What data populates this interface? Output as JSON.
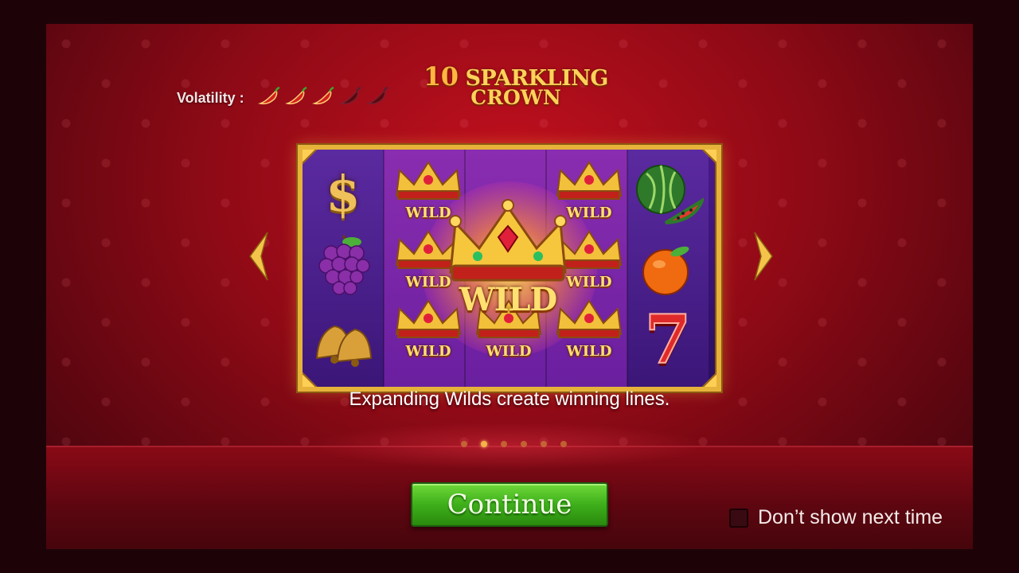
{
  "game": {
    "title_line1_number": "10",
    "title_line1_word": "SPARKLING",
    "title_line2": "CROWN"
  },
  "volatility": {
    "label": "Volatility :",
    "level": 3,
    "max": 5,
    "icon": "chili-pepper-icon"
  },
  "slide": {
    "caption": "Expanding Wilds create winning lines.",
    "wild_small_label": "WILD",
    "wild_big_label": "WILD",
    "symbols": {
      "dollar": "$",
      "seven": "7"
    }
  },
  "pagination": {
    "count": 6,
    "active_index": 1
  },
  "controls": {
    "continue_label": "Continue",
    "dont_show_label": "Don’t show next time",
    "dont_show_checked": false
  },
  "colors": {
    "background": "#8f0a16",
    "frame_gold": "#e6b23a",
    "button_green": "#3eaf1a",
    "chili_active": "#d42020",
    "chili_inactive": "#5a0810"
  }
}
